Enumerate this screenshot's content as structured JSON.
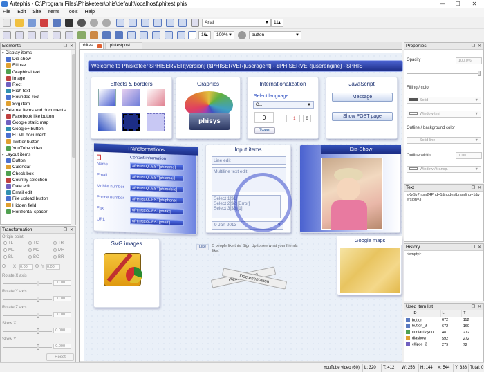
{
  "window": {
    "title": "Artephis - C:\\Program Files\\Phisketeer\\phis\\default\\localhost\\phitest.phis",
    "minimize": "—",
    "maximize": "☐",
    "close": "✕"
  },
  "menu": [
    "File",
    "Edit",
    "Site",
    "Items",
    "Tools",
    "Help"
  ],
  "toolbar": {
    "font_family": "Arial",
    "font_size": "11",
    "grid_size": "16",
    "zoom": "100%",
    "item_selector": "button"
  },
  "elements_panel": {
    "title": "Elements",
    "groups": [
      {
        "label": "Display items",
        "items": [
          "Dia show",
          "Ellipse",
          "Graphical text",
          "Image",
          "Rect",
          "Rich text",
          "Rounded rect",
          "Svg item"
        ]
      },
      {
        "label": "External items and documents",
        "items": [
          "Facebook like button",
          "Google static map",
          "Google+ button",
          "HTML document",
          "Twitter button",
          "YouTube video"
        ]
      },
      {
        "label": "Layout items",
        "items": [
          "Button",
          "Calendar",
          "Check box",
          "Country selection",
          "Date edit",
          "Email edit",
          "File upload button",
          "Hidden field",
          "Horizontal spacer"
        ]
      }
    ]
  },
  "transformation_panel": {
    "title": "Transformation",
    "origin_label": "Origin point",
    "origin_options": [
      [
        "TL",
        "TC",
        "TR"
      ],
      [
        "ML",
        "MC",
        "MR"
      ],
      [
        "BL",
        "BC",
        "BR"
      ]
    ],
    "x_label": "X",
    "x_value": "0.00",
    "y_label": "Y",
    "y_value": "0.00",
    "rotate_x_label": "Rotate X axis",
    "rotate_x_value": "0.00",
    "rotate_y_label": "Rotate Y axis",
    "rotate_y_value": "0.00",
    "rotate_z_label": "Rotate Z axis",
    "rotate_z_value": "0.00",
    "skew_x_label": "Skew X",
    "skew_x_value": "0.000",
    "skew_y_label": "Skew Y",
    "skew_y_value": "0.000",
    "reset_label": "Reset"
  },
  "tabs": [
    {
      "label": "phitest",
      "active": true
    },
    {
      "label": "phitestpost",
      "active": false
    }
  ],
  "page": {
    "banner": "Welcome to Phisketeer $PHISERVER[version] ($PHISERVER[useragent] - $PHISERVER[userengine] - $PHIS",
    "effects_title": "Effects & borders",
    "graphics_title": "Graphics",
    "graphics_label": "phisys",
    "i18n_title": "Internationalization",
    "select_language_label": "Select language",
    "language_value": "C...",
    "count_value": "0",
    "gplus_label": "+1",
    "gplus_count": "0",
    "tweet_label": "Tweet",
    "js_title": "JavaScript",
    "message_button": "Message",
    "show_post_button": "Show POST page",
    "transformations_title": "Transformations",
    "contact_info": "Contact information",
    "fields": [
      {
        "label": "Name",
        "value": "$PHIREQUEST[phiname]"
      },
      {
        "label": "Email",
        "value": "$PHIREQUEST[phiemail]"
      },
      {
        "label": "Mobile number",
        "value": "$PHIREQUEST[phimobile]"
      },
      {
        "label": "Phone number",
        "value": "$PHIREQUEST[phiphone]"
      },
      {
        "label": "Fax",
        "value": "$PHIREQUEST[phifax]"
      },
      {
        "label": "URL",
        "value": "$PHIREQUEST[phiurl]"
      }
    ],
    "input_title": "Input items",
    "line_edit": "Line edit",
    "multiline_edit": "Multiline text edit",
    "list_items": [
      "Select 1[$1]",
      "Select 2[$2][Error]",
      "Select 3[$3][1]"
    ],
    "date_value": "9 Jan 2013",
    "dia_title": "Dia-Show",
    "svg_title": "SVG images",
    "fb_like": "Like",
    "fb_text": "5 people like this. Sign Up to see what your friends like.",
    "getting_started": "Getting started",
    "documentation": "Documentation",
    "maps_title": "Google maps"
  },
  "properties_panel": {
    "title": "Properties",
    "opacity_label": "Opacity",
    "opacity_value": "100.0%",
    "filling_label": "Filling / color",
    "filling_value": "Solid",
    "window_text_value": "Window text",
    "outline_label": "Outline / background color",
    "outline_value": "Solid line",
    "outline_width_label": "Outline width",
    "outline_width_value": "1.00",
    "window_transp_value": "Window / transp."
  },
  "text_panel": {
    "title": "Text",
    "content": "sKySv?hum24Phd=1&nodestbranding=1&version=3"
  },
  "history_panel": {
    "title": "History",
    "entry": "<empty>"
  },
  "used_list_panel": {
    "title": "Used item list",
    "columns": [
      "ID",
      "L",
      "T"
    ],
    "rows": [
      {
        "id": "button",
        "l": "672",
        "t": "112"
      },
      {
        "id": "button_3",
        "l": "672",
        "t": "160"
      },
      {
        "id": "contactlayout",
        "l": "48",
        "t": "272"
      },
      {
        "id": "diashow",
        "l": "592",
        "t": "272"
      },
      {
        "id": "ellipse_3",
        "l": "279",
        "t": "72"
      }
    ]
  },
  "statusbar": {
    "item": "YouTube video (60)",
    "l": "L: 320",
    "t": "T: 412",
    "w": "W: 256",
    "h": "H: 144",
    "x": "X: 544",
    "y": "Y: 338",
    "total": "Total: 0"
  },
  "colors": {
    "accent": "#1c2d86",
    "banner_bg": "#2a3fa8",
    "canvas_bg": "#eaf0f8"
  }
}
